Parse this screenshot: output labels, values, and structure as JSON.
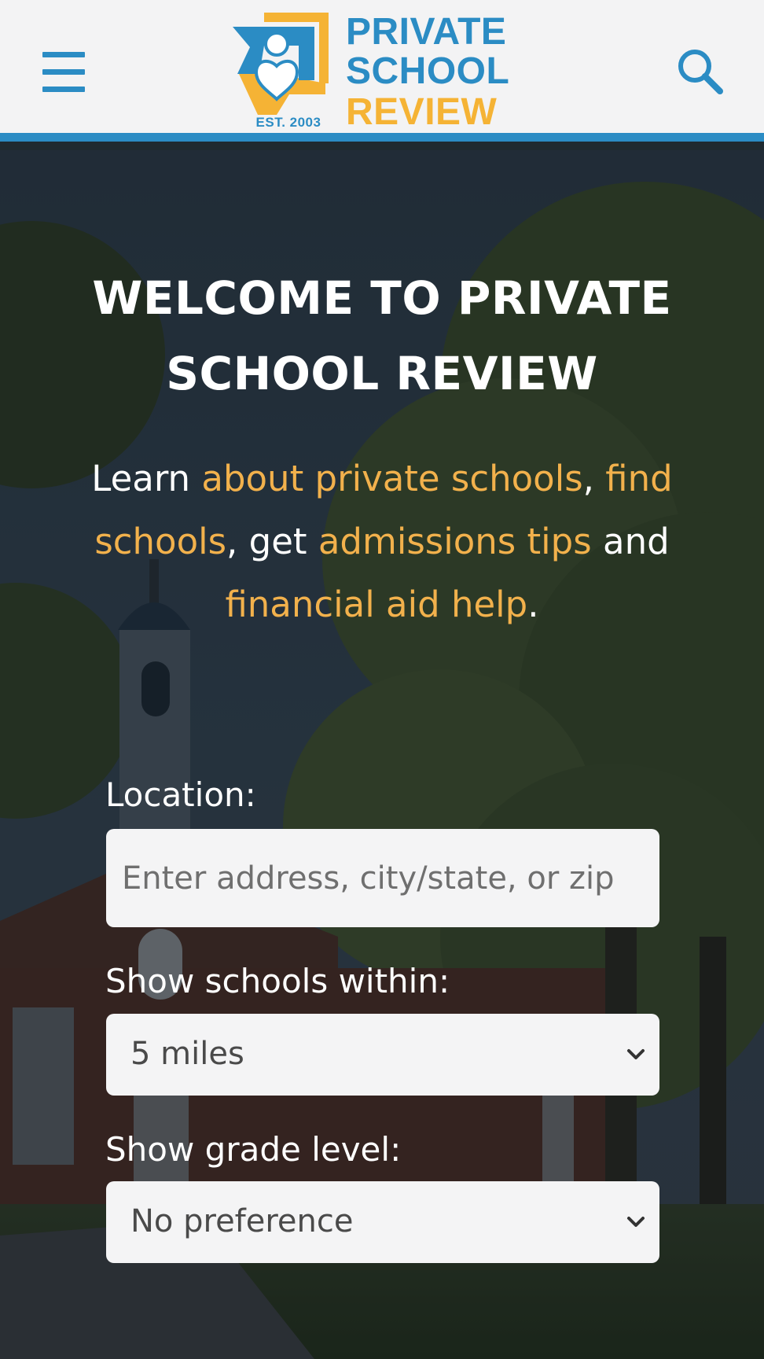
{
  "header": {
    "logo": {
      "line1": "PRIVATE",
      "line2": "SCHOOL",
      "line3": "REVIEW",
      "est": "EST. 2003"
    },
    "icons": {
      "menu": "hamburger-menu-icon",
      "search": "search-icon"
    },
    "colors": {
      "brand_blue": "#2b8cc4",
      "brand_gold": "#f5b335"
    }
  },
  "hero": {
    "title": "WELCOME TO PRIVATE SCHOOL REVIEW",
    "intro": {
      "t1": "Learn ",
      "link1": "about private schools",
      "t2": ", ",
      "link2": "find schools",
      "t3": ", get ",
      "link3": "admissions tips",
      "t4": " and ",
      "link4": "financial aid help",
      "t5": "."
    },
    "link_color": "#f2b14c"
  },
  "form": {
    "location_label": "Location:",
    "location_placeholder": "Enter address, city/state, or zip",
    "location_value": "",
    "within_label": "Show schools within:",
    "within_selected": "5 miles",
    "grade_label": "Show grade level:",
    "grade_selected": "No preference"
  }
}
